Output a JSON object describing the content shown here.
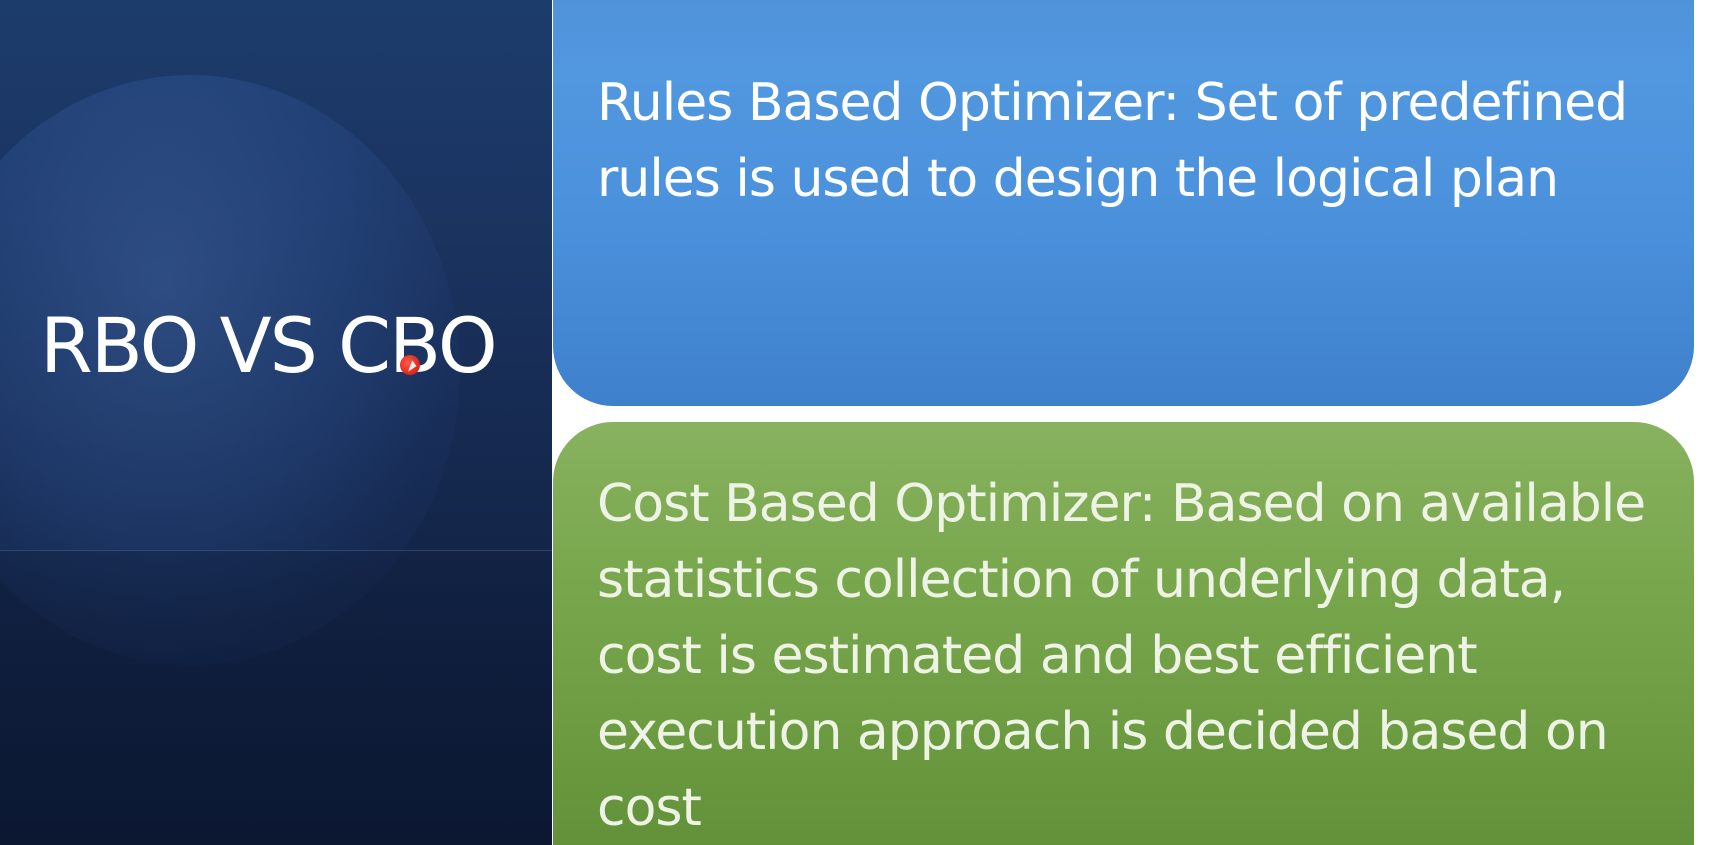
{
  "slide": {
    "title": "RBO VS CBO",
    "rbo_description": "Rules Based Optimizer: Set of predefined rules is used to design the logical plan",
    "cbo_description": "Cost Based Optimizer: Based on available statistics collection of underlying data, cost is estimated and best efficient execution approach is decided based on cost"
  },
  "colors": {
    "title_panel": "#17305a",
    "rbo_box": "#4a90db",
    "cbo_box": "#76a34b",
    "text": "#ffffff",
    "cursor_highlight": "#d8261a"
  },
  "icons": {
    "pointer": "mouse-pointer-icon"
  }
}
